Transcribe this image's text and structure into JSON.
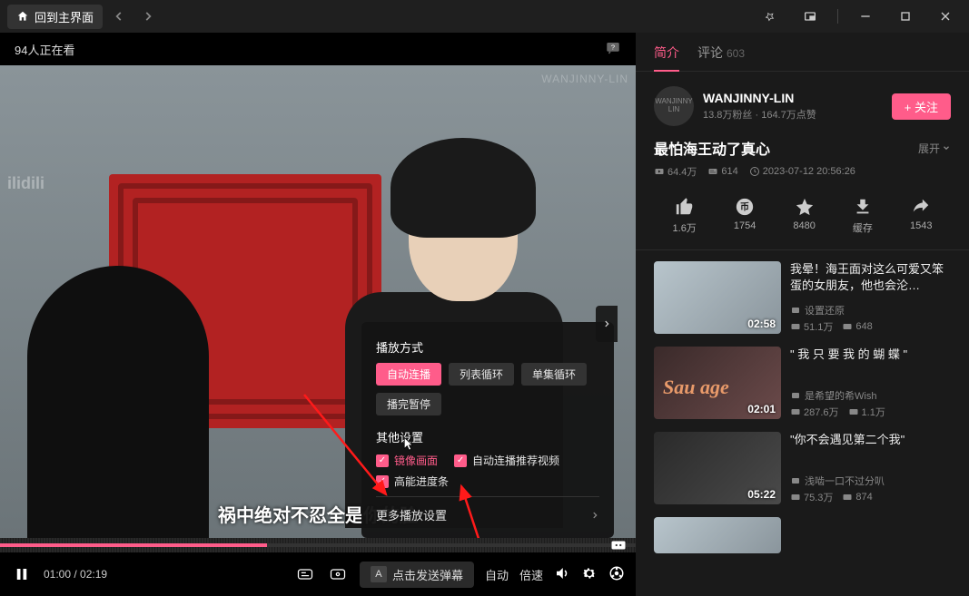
{
  "titlebar": {
    "home": "回到主界面"
  },
  "player": {
    "viewers": "94人正在看",
    "subtitle": "祸中绝对不忍全是你的脸",
    "wm_left": "ilibili",
    "wm_right": "WANJINNY-LIN",
    "time_current": "01:00",
    "time_total": "02:19",
    "danmaku_prompt": "点击发送弹幕",
    "auto": "自动",
    "speed": "倍速"
  },
  "settings": {
    "play_mode_title": "播放方式",
    "modes": [
      "自动连播",
      "列表循环",
      "单集循环"
    ],
    "pause_after": "播完暂停",
    "other_title": "其他设置",
    "mirror": "镜像画面",
    "autonext": "自动连播推荐视频",
    "hd_progress": "高能进度条",
    "more": "更多播放设置"
  },
  "sidebar": {
    "tabs": {
      "intro": "简介",
      "comments": "评论",
      "comment_count": "603"
    },
    "uploader": {
      "name": "WANJINNY-LIN",
      "fans": "13.8万粉丝",
      "likes": "164.7万点赞",
      "follow": "+ 关注"
    },
    "video": {
      "title": "最怕海王动了真心",
      "expand": "展开",
      "views": "64.4万",
      "danmaku": "614",
      "date": "2023-07-12 20:56:26"
    },
    "actions": {
      "like": "1.6万",
      "coin": "1754",
      "fav": "8480",
      "cache": "缓存",
      "share": "1543"
    },
    "recs": [
      {
        "title": "我晕！海王面对这么可爱又笨蛋的女朋友，他也会沦…",
        "up": "设置还原",
        "views": "51.1万",
        "dm": "648",
        "dur": "02:58"
      },
      {
        "title": "\" 我 只 要 我 的 蝴 蝶 \"",
        "up": "是希望的希Wish",
        "views": "287.6万",
        "dm": "1.1万",
        "dur": "02:01"
      },
      {
        "title": "\"你不会遇见第二个我\"",
        "up": "浅啮一口不过分叭",
        "views": "75.3万",
        "dm": "874",
        "dur": "05:22"
      }
    ]
  }
}
